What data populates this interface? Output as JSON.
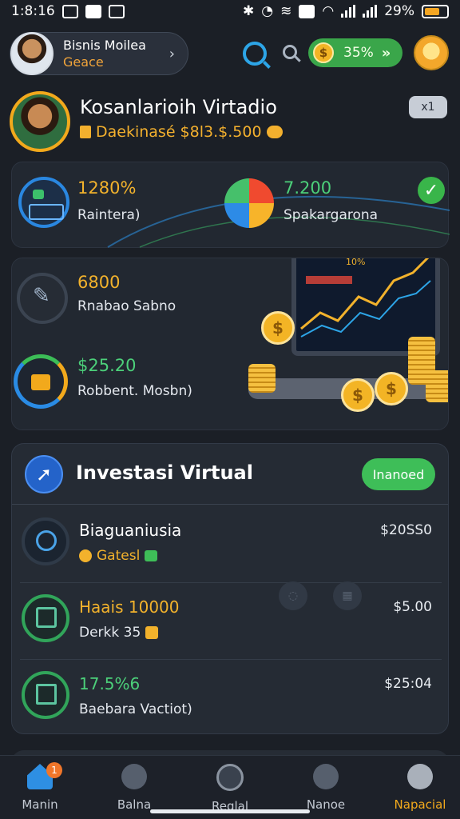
{
  "status_bar": {
    "time": "1:8:16",
    "battery": "29%"
  },
  "profile": {
    "name": "Bisnis Moilea",
    "subtitle": "Geace"
  },
  "coins": {
    "value": "35%"
  },
  "hero": {
    "title": "Kosanlarioih Virtadio",
    "subtitle": "Daekinasé $8l3.$.500",
    "badge": "x1"
  },
  "stats_top": [
    {
      "value": "1280%",
      "label": "Raintera)",
      "color": "#f2b22c"
    },
    {
      "value": "7.200",
      "label": "Spakargarona",
      "color": "#4cd07a"
    }
  ],
  "stats_mid": [
    {
      "value": "6800",
      "label": "Rnabao Sabno",
      "color": "#f2b22c"
    },
    {
      "value": "$25.20",
      "label": "Robbent. Mosbn)",
      "color": "#4cd07a"
    }
  ],
  "chart_card": {
    "coin_symbol": "$",
    "screen_label": "10%"
  },
  "investasi": {
    "title": "Investasi Virtual",
    "button_label": "Inanoed",
    "rows": [
      {
        "title": "Biaguaniusia",
        "subtitle": "Gatesl",
        "amount": "$20SS0",
        "title_color": "#ffffff"
      },
      {
        "title": "Haais 10000",
        "subtitle": "Derkk 35",
        "amount": "$5.00",
        "title_color": "#f2b22c"
      },
      {
        "title": "17.5%6",
        "subtitle": "Baebara Vactiot)",
        "amount": "$25:04",
        "title_color": "#4cd07a"
      }
    ]
  },
  "bottom_nav": {
    "items": [
      {
        "label": "Manin",
        "icon": "home-icon",
        "badge": "1"
      },
      {
        "label": "Balna",
        "icon": "shield-icon"
      },
      {
        "label": "Reqlal",
        "icon": "face-icon"
      },
      {
        "label": "Nanoe",
        "icon": "dots-icon"
      },
      {
        "label": "Napacial",
        "icon": "profile-icon"
      }
    ]
  },
  "colors": {
    "background": "#1b1f26",
    "accent_gold": "#f2b22c",
    "accent_green": "#3ebe58",
    "accent_blue": "#2a87e0"
  }
}
